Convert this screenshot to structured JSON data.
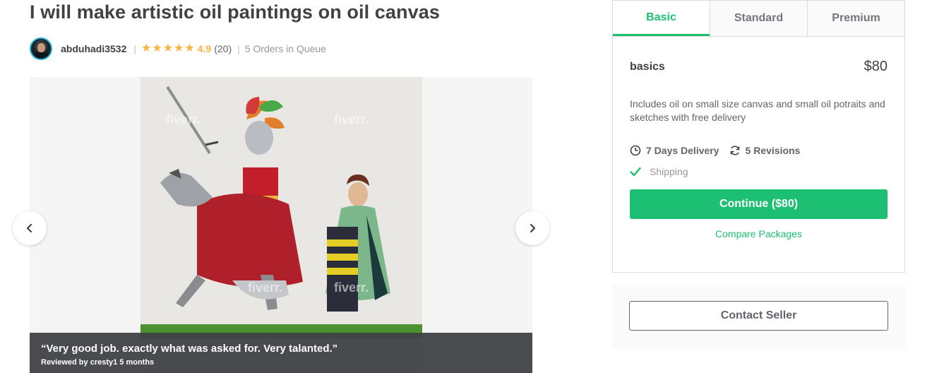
{
  "gig": {
    "title": "I will make artistic oil paintings on oil canvas"
  },
  "seller": {
    "username": "abduhadi3532",
    "rating": "4.9",
    "review_count": "(20)",
    "queue": "5 Orders in Queue",
    "stars": 5
  },
  "gallery": {
    "watermark": "fiverr.",
    "review_quote": "“Very good job. exactly what was asked for. Very talanted.”",
    "review_meta": "Reviewed by cresty1 5 months"
  },
  "package": {
    "tabs": [
      {
        "label": "Basic",
        "active": true
      },
      {
        "label": "Standard",
        "active": false
      },
      {
        "label": "Premium",
        "active": false
      }
    ],
    "name": "basics",
    "price": "$80",
    "description": "Includes oil on small size canvas and small oil potraits and sketches with free delivery",
    "delivery": "7 Days Delivery",
    "revisions": "5 Revisions",
    "includes": [
      "Shipping"
    ],
    "continue_label": "Continue ($80)",
    "compare_label": "Compare Packages"
  },
  "contact": {
    "label": "Contact Seller"
  },
  "colors": {
    "accent": "#1dbf73",
    "star": "#ffb33e",
    "text": "#404145"
  }
}
